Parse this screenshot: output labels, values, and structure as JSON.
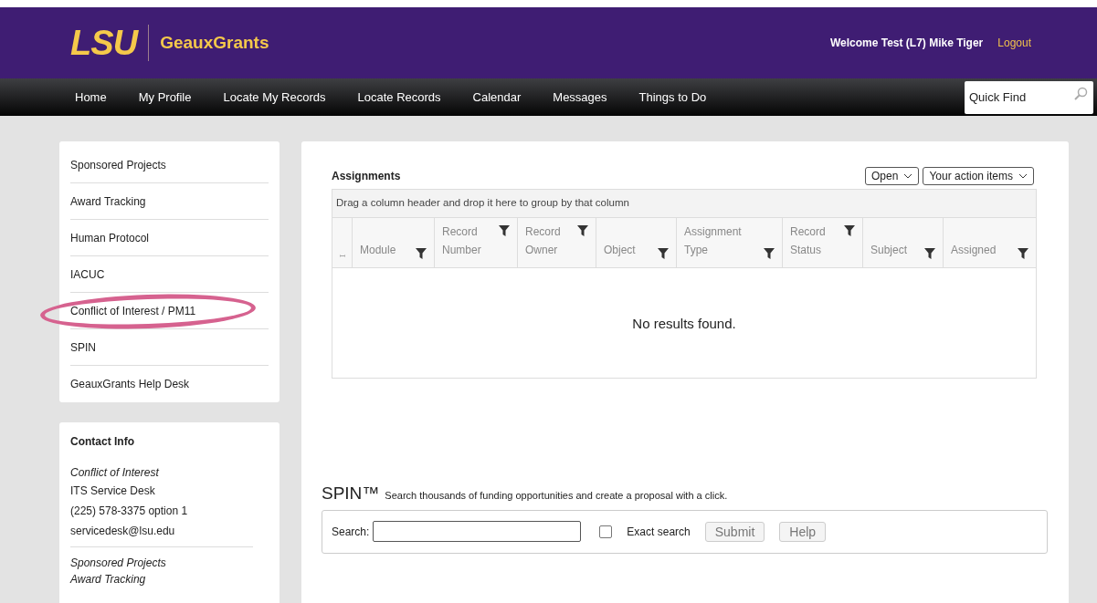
{
  "header": {
    "logo": "LSU",
    "app_name": "GeauxGrants",
    "welcome": "Welcome Test (L7) Mike Tiger",
    "logout": "Logout"
  },
  "nav": {
    "items": [
      "Home",
      "My Profile",
      "Locate My Records",
      "Locate Records",
      "Calendar",
      "Messages",
      "Things to Do"
    ],
    "quick_find": {
      "placeholder": "Quick Find"
    }
  },
  "sidebar": {
    "items": [
      {
        "label": "Sponsored Projects",
        "circled": false
      },
      {
        "label": "Award Tracking",
        "circled": false
      },
      {
        "label": "Human Protocol",
        "circled": false
      },
      {
        "label": "IACUC",
        "circled": false
      },
      {
        "label": "Conflict of Interest / PM11",
        "circled": true
      },
      {
        "label": "SPIN",
        "circled": false
      },
      {
        "label": "GeauxGrants Help Desk",
        "circled": false
      }
    ]
  },
  "contact": {
    "title": "Contact Info",
    "groups": [
      {
        "lines": [
          {
            "text": "Conflict of Interest",
            "kind": "heading"
          },
          {
            "text": "ITS Service Desk",
            "kind": "plain"
          },
          {
            "text": "(225) 578-3375 option 1",
            "kind": "plain"
          },
          {
            "text": "servicedesk@lsu.edu",
            "kind": "plain"
          }
        ]
      },
      {
        "lines": [
          {
            "text": "Sponsored Projects",
            "kind": "heading"
          },
          {
            "text": "Award Tracking",
            "kind": "heading"
          }
        ]
      }
    ]
  },
  "assignments": {
    "title": "Assignments",
    "filters": [
      "Open",
      "Your action items"
    ],
    "group_hint": "Drag a column header and drop it here to group by that column",
    "columns": [
      {
        "label": "Module"
      },
      {
        "label": "Record Number"
      },
      {
        "label": "Record Owner"
      },
      {
        "label": "Object"
      },
      {
        "label": "Assignment Type"
      },
      {
        "label": "Record Status"
      },
      {
        "label": "Subject"
      },
      {
        "label": "Assigned"
      }
    ],
    "empty_message": "No results found."
  },
  "spin": {
    "title": "SPIN™",
    "tagline": "Search thousands of funding opportunities and create a proposal with a click.",
    "search_label": "Search:",
    "exact_search": {
      "label": "Exact search",
      "checked": false
    },
    "buttons": [
      "Submit",
      "Help"
    ]
  }
}
